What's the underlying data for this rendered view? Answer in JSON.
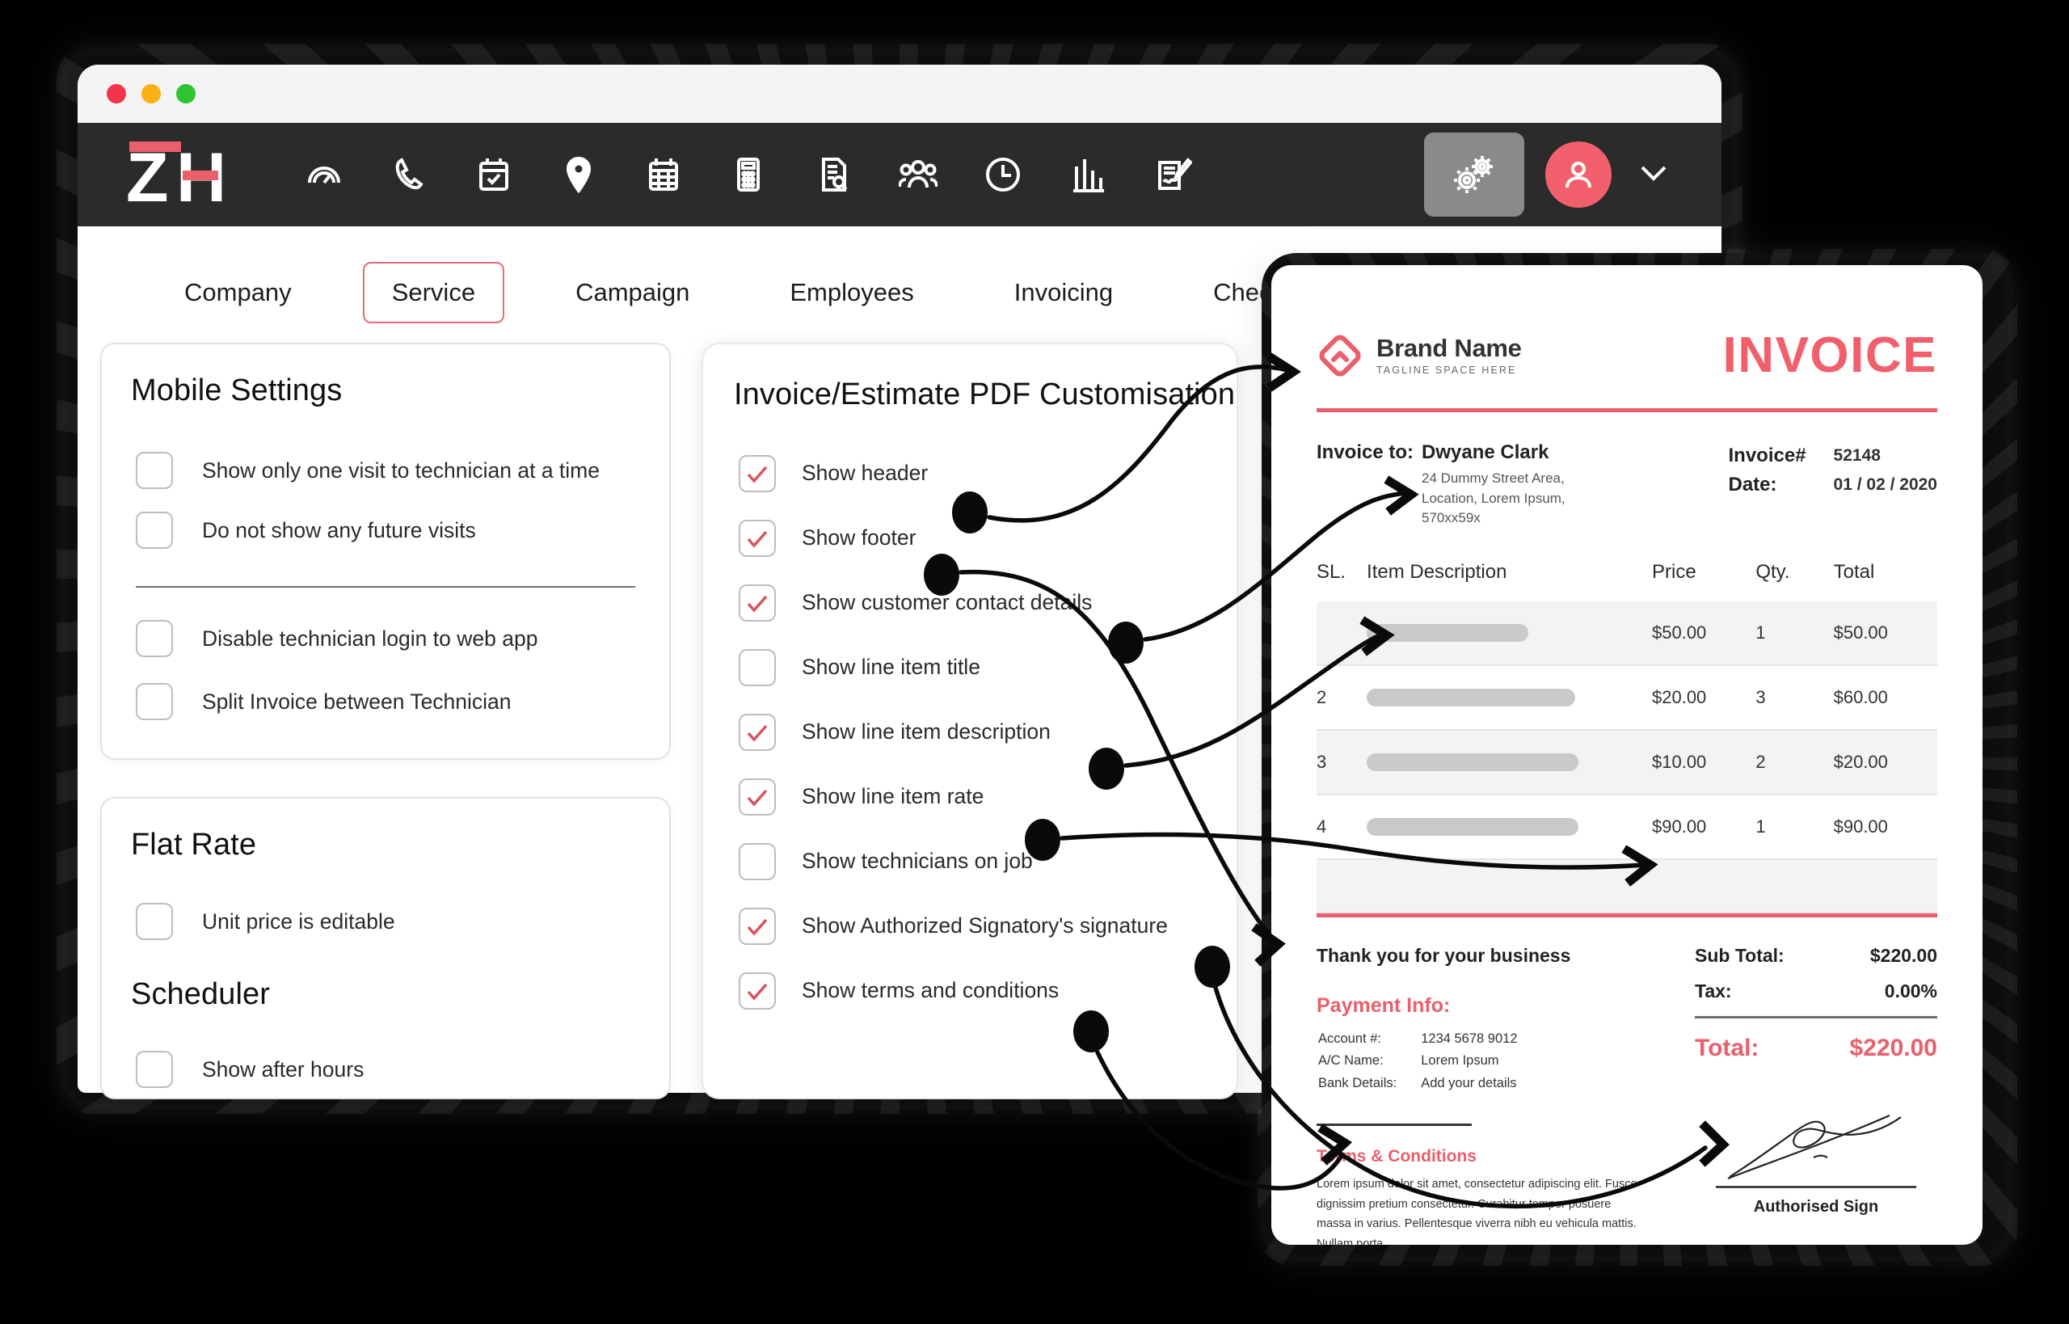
{
  "window": {
    "traffic_lights": [
      "close",
      "minimize",
      "maximize"
    ],
    "logo_text": "ZH"
  },
  "navbar": {
    "icons": [
      {
        "name": "speedometer-icon",
        "label": "Dashboard"
      },
      {
        "name": "phone-icon",
        "label": "Calls"
      },
      {
        "name": "calendar-check-icon",
        "label": "Jobs"
      },
      {
        "name": "location-pin-icon",
        "label": "Map"
      },
      {
        "name": "calendar-grid-icon",
        "label": "Schedule"
      },
      {
        "name": "calculator-icon",
        "label": "Estimates"
      },
      {
        "name": "document-search-icon",
        "label": "Reports"
      },
      {
        "name": "people-icon",
        "label": "Customers"
      },
      {
        "name": "clock-icon",
        "label": "Timesheets"
      },
      {
        "name": "bar-chart-icon",
        "label": "Analytics"
      },
      {
        "name": "signature-document-icon",
        "label": "Forms"
      }
    ],
    "settings_button": "gears-icon",
    "avatar": "user-avatar-icon",
    "chevron": "chevron-down-icon",
    "accent_color": "#f2606d",
    "bar_color": "#2b2b2b"
  },
  "tabs": {
    "items": [
      {
        "label": "Company",
        "active": false
      },
      {
        "label": "Service",
        "active": true
      },
      {
        "label": "Campaign",
        "active": false
      },
      {
        "label": "Employees",
        "active": false
      },
      {
        "label": "Invoicing",
        "active": false
      },
      {
        "label": "Checklist/Forms",
        "active": false
      }
    ],
    "active_border_color": "#ea6a77"
  },
  "mobile_settings": {
    "title": "Mobile Settings",
    "group_one": [
      {
        "label": "Show only one visit to technician at a time",
        "checked": false
      },
      {
        "label": "Do not show any future visits",
        "checked": false
      }
    ],
    "group_two": [
      {
        "label": "Disable technician login to web app",
        "checked": false
      },
      {
        "label": "Split Invoice between Technician",
        "checked": false
      }
    ]
  },
  "flat_rate": {
    "title": "Flat Rate",
    "items": [
      {
        "label": "Unit price is editable",
        "checked": false
      }
    ]
  },
  "scheduler": {
    "title": "Scheduler",
    "items": [
      {
        "label": "Show after hours",
        "checked": false
      }
    ]
  },
  "pdf_customisation": {
    "title": "Invoice/Estimate PDF Customisation",
    "check_color": "#d9535f",
    "items": [
      {
        "label": "Show header",
        "checked": true,
        "connector": true
      },
      {
        "label": "Show footer",
        "checked": true,
        "connector": true
      },
      {
        "label": "Show customer contact details",
        "checked": true,
        "connector": true
      },
      {
        "label": "Show line item title",
        "checked": false,
        "connector": false
      },
      {
        "label": "Show line item description",
        "checked": true,
        "connector": true
      },
      {
        "label": "Show line item rate",
        "checked": true,
        "connector": true
      },
      {
        "label": "Show technicians on job",
        "checked": false,
        "connector": false
      },
      {
        "label": "Show Authorized Signatory's signature",
        "checked": true,
        "connector": true
      },
      {
        "label": "Show terms and conditions",
        "checked": true,
        "connector": true
      }
    ]
  },
  "invoice": {
    "brand_name": "Brand Name",
    "tagline": "TAGLINE SPACE HERE",
    "heading": "INVOICE",
    "accent_color": "#ea5f6c",
    "bill_to_label": "Invoice to:",
    "bill_to_name": "Dwyane Clark",
    "bill_to_address": "24 Dummy Street Area,\nLocation, Lorem Ipsum,\n570xx59x",
    "invoice_number_label": "Invoice#",
    "invoice_number": "52148",
    "date_label": "Date:",
    "date_value": "01 / 02 / 2020",
    "table_headers": [
      "SL.",
      "Item Description",
      "Price",
      "Qty.",
      "Total"
    ],
    "rows": [
      {
        "sl": "1",
        "description": "",
        "price": "$50.00",
        "qty": "1",
        "total": "$50.00"
      },
      {
        "sl": "2",
        "description": "",
        "price": "$20.00",
        "qty": "3",
        "total": "$60.00"
      },
      {
        "sl": "3",
        "description": "",
        "price": "$10.00",
        "qty": "2",
        "total": "$20.00"
      },
      {
        "sl": "4",
        "description": "",
        "price": "$90.00",
        "qty": "1",
        "total": "$90.00"
      }
    ],
    "thank_you": "Thank you for your business",
    "payment_info_title": "Payment Info:",
    "payment_rows": [
      {
        "label": "Account #:",
        "value": "1234 5678 9012"
      },
      {
        "label": "A/C Name:",
        "value": "Lorem Ipsum"
      },
      {
        "label": "Bank Details:",
        "value": "Add your details"
      }
    ],
    "terms_title": "Terms & Conditions",
    "terms_body": "Lorem ipsum dolor sit amet, consectetur adipiscing elit. Fusce dignissim pretium consectetur. Curabitur tempor posuere massa in varius. Pellentesque viverra nibh eu vehicula mattis. Nullam porta",
    "sub_total_label": "Sub Total:",
    "sub_total_value": "$220.00",
    "tax_label": "Tax:",
    "tax_value": "0.00%",
    "total_label": "Total:",
    "total_value": "$220.00",
    "signature_caption": "Authorised Sign"
  }
}
